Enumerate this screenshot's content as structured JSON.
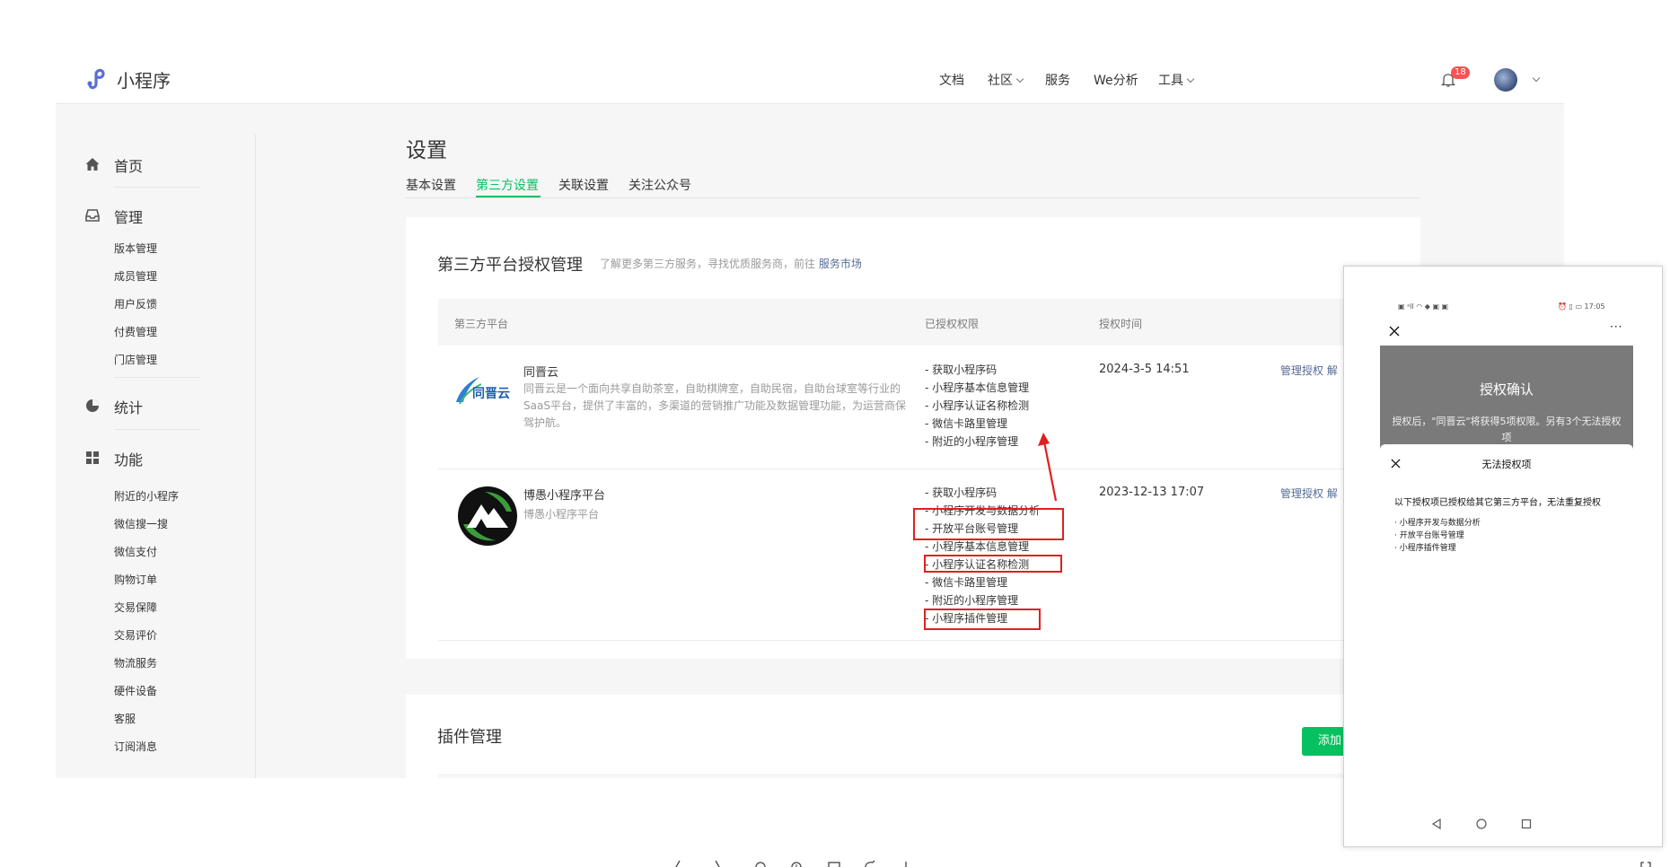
{
  "header": {
    "logo_text": "小程序",
    "nav": [
      "文档",
      "社区",
      "服务",
      "We分析",
      "工具"
    ],
    "notification_count": "18"
  },
  "sidebar": {
    "sections": [
      {
        "label": "首页",
        "icon": "home-icon"
      },
      {
        "label": "管理",
        "icon": "inbox-icon"
      },
      {
        "label": "统计",
        "icon": "pie-chart-icon"
      },
      {
        "label": "功能",
        "icon": "grid-icon"
      }
    ],
    "manage_items": [
      "版本管理",
      "成员管理",
      "用户反馈",
      "付费管理",
      "门店管理"
    ],
    "feature_items": [
      "附近的小程序",
      "微信搜一搜",
      "微信支付",
      "购物订单",
      "交易保障",
      "交易评价",
      "物流服务",
      "硬件设备",
      "客服",
      "订阅消息"
    ]
  },
  "page": {
    "title": "设置",
    "tabs": [
      "基本设置",
      "第三方设置",
      "关联设置",
      "关注公众号"
    ],
    "active_tab": "第三方设置"
  },
  "auth_card": {
    "title": "第三方平台授权管理",
    "desc": "了解更多第三方服务，寻找优质服务商，前往",
    "desc_link": "服务市场",
    "columns": [
      "第三方平台",
      "已授权权限",
      "授权时间"
    ],
    "rows": [
      {
        "name": "同晋云",
        "logo_text": "同晋云",
        "desc": "同晋云是一个面向共享自助茶室，自助棋牌室，自助民宿，自助台球室等行业的SaaS平台，提供了丰富的，多渠道的营销推广功能及数据管理功能，为运营商保驾护航。",
        "perms": [
          "- 获取小程序码",
          "- 小程序基本信息管理",
          "- 小程序认证名称检测",
          "- 微信卡路里管理",
          "- 附近的小程序管理"
        ],
        "time": "2024-3-5 14:51",
        "actions": "管理授权  解"
      },
      {
        "name": "博愚小程序平台",
        "desc": "博愚小程序平台",
        "perms": [
          "- 获取小程序码",
          "- 小程序开发与数据分析",
          "- 开放平台账号管理",
          "- 小程序基本信息管理",
          "- 小程序认证名称检测",
          "- 微信卡路里管理",
          "- 附近的小程序管理",
          "- 小程序插件管理"
        ],
        "time": "2023-12-13 17:07",
        "actions": "管理授权  解"
      }
    ]
  },
  "plugin_card": {
    "title": "插件管理",
    "add_button": "添加"
  },
  "phone": {
    "status_left": "▣ ᵃll ◠ ◆ ▣ ▣",
    "status_right": "⏰ ▯ ▭ 17:05",
    "dim_title": "授权确认",
    "dim_text": "授权后，\"同晋云\"将获得5项权限。另有3个无法授权项",
    "sheet_title": "无法授权项",
    "sheet_lead": "以下授权项已授权给其它第三方平台，无法重复授权",
    "sheet_items": [
      "· 小程序开发与数据分析",
      "· 开放平台账号管理",
      "· 小程序插件管理"
    ],
    "more": "···"
  },
  "colors": {
    "accent": "#07c160",
    "link": "#576b95",
    "highlight_box": "#e02020",
    "badge": "#fa5151"
  }
}
